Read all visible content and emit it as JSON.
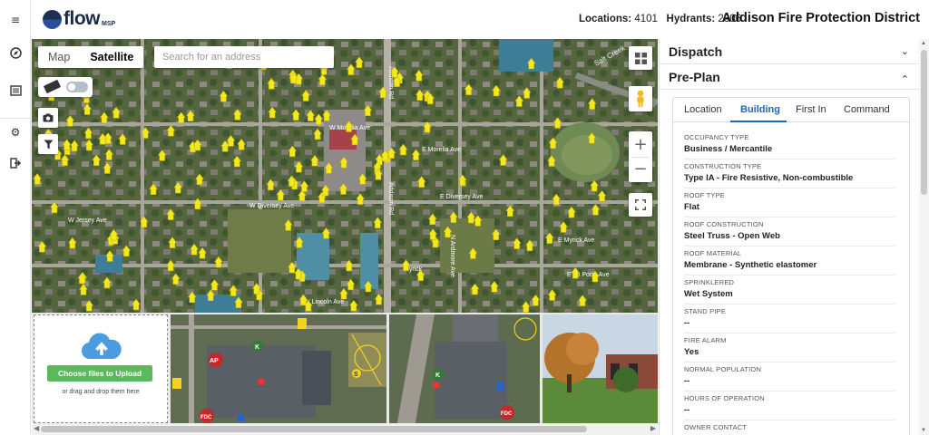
{
  "app": {
    "name": "flow",
    "suffix": "MSP"
  },
  "rail": {
    "icons": [
      "menu-collapse-icon",
      "compass-icon",
      "book-icon",
      "gear-icon",
      "logout-icon"
    ]
  },
  "header": {
    "locations_label": "Locations:",
    "locations_value": "4101",
    "hydrants_label": "Hydrants:",
    "hydrants_value": "2306",
    "district": "Addison Fire Protection District"
  },
  "map": {
    "tab_map": "Map",
    "tab_satellite": "Satellite",
    "active_tab": "Satellite",
    "search_placeholder": "Search for an address",
    "street_labels": [
      "W Morelia Ave",
      "E Morelia Ave",
      "W Diversey Ave",
      "E Diversey Ave",
      "W Jersey Ave",
      "E Myrick Ave",
      "Myrick",
      "E La Porte Ave",
      "W Lincoln Ave",
      "Addison Rd",
      "Addison Rd",
      "N Ardmore Ave",
      "Salt Creek"
    ],
    "colors": {
      "hydrant": "#f3e81c",
      "satellite": "#4c5a40"
    }
  },
  "upload": {
    "button": "Choose files to Upload",
    "note": "or drag and drop them here"
  },
  "preplan_badges": [
    "AP",
    "K",
    "FDC",
    "S",
    "K",
    "FDC"
  ],
  "panel": {
    "dispatch": "Dispatch",
    "preplan": "Pre-Plan",
    "tabs": [
      "Location",
      "Building",
      "First In",
      "Command"
    ],
    "active_tab": "Building",
    "fields": [
      {
        "label": "OCCUPANCY TYPE",
        "value": "Business / Mercantile"
      },
      {
        "label": "CONSTRUCTION TYPE",
        "value": "Type IA - Fire Resistive, Non-combustible"
      },
      {
        "label": "ROOF TYPE",
        "value": "Flat"
      },
      {
        "label": "ROOF CONSTRUCTION",
        "value": "Steel Truss - Open Web"
      },
      {
        "label": "ROOF MATERIAL",
        "value": "Membrane - Synthetic elastomer"
      },
      {
        "label": "SPRINKLERED",
        "value": "Wet System"
      },
      {
        "label": "STAND PIPE",
        "value": "--"
      },
      {
        "label": "FIRE ALARM",
        "value": "Yes"
      },
      {
        "label": "NORMAL POPULATION",
        "value": "--"
      },
      {
        "label": "HOURS OF OPERATION",
        "value": "--"
      },
      {
        "label": "OWNER CONTACT",
        "value": ""
      }
    ],
    "accent": "#2366b5"
  }
}
